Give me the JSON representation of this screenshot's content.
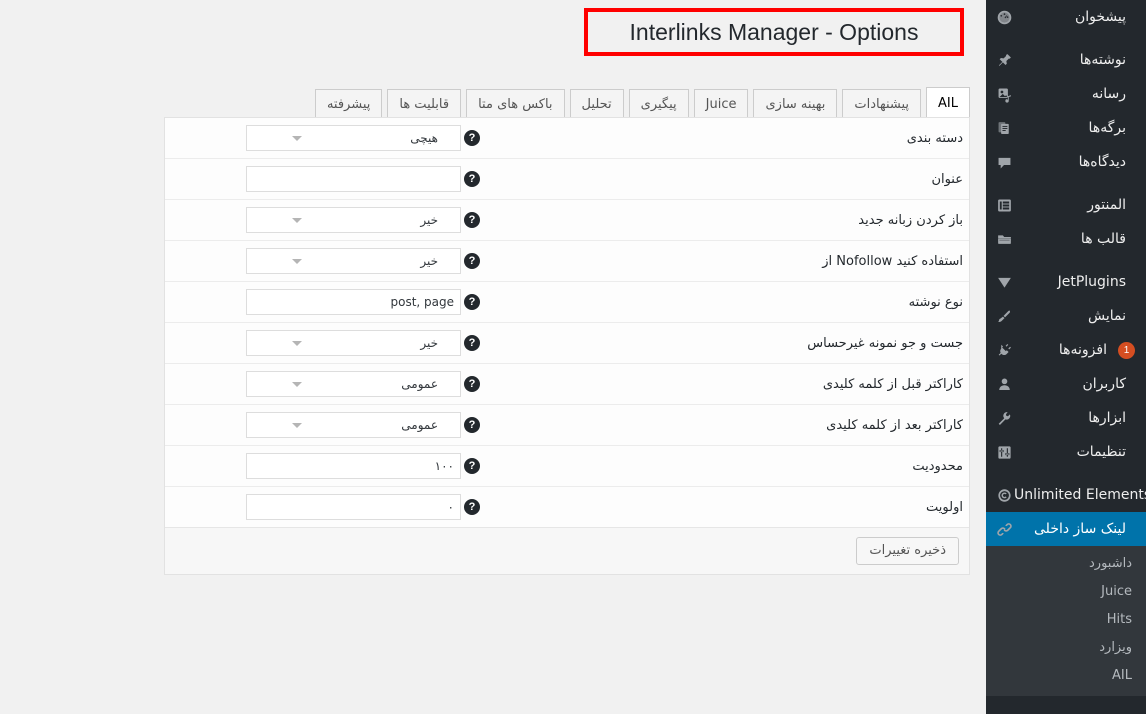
{
  "header": {
    "title": "Interlinks Manager - Options"
  },
  "sidebar": {
    "items": [
      {
        "label": "پیشخوان",
        "icon": "dashboard-icon",
        "current": false,
        "badge": null
      },
      {
        "label": "نوشته‌ها",
        "icon": "pin-icon",
        "current": false,
        "badge": null
      },
      {
        "label": "رسانه",
        "icon": "media-icon",
        "current": false,
        "badge": null
      },
      {
        "label": "برگه‌ها",
        "icon": "pages-icon",
        "current": false,
        "badge": null
      },
      {
        "label": "دیدگاه‌ها",
        "icon": "comments-icon",
        "current": false,
        "badge": null
      },
      {
        "label": "المنتور",
        "icon": "elementor-icon",
        "current": false,
        "badge": null
      },
      {
        "label": "قالب ها",
        "icon": "folder-icon",
        "current": false,
        "badge": null
      },
      {
        "label": "JetPlugins",
        "icon": "jet-triangle-icon",
        "current": false,
        "badge": null
      },
      {
        "label": "نمایش",
        "icon": "appearance-brush-icon",
        "current": false,
        "badge": null
      },
      {
        "label": "افزونه‌ها",
        "icon": "plugin-icon",
        "current": false,
        "badge": "1"
      },
      {
        "label": "کاربران",
        "icon": "users-icon",
        "current": false,
        "badge": null
      },
      {
        "label": "ابزارها",
        "icon": "tools-wrench-icon",
        "current": false,
        "badge": null
      },
      {
        "label": "تنظیمات",
        "icon": "settings-sliders-icon",
        "current": false,
        "badge": null
      },
      {
        "label": "Unlimited Elements",
        "icon": "unlimited-elements-icon",
        "current": false,
        "badge": null
      },
      {
        "label": "لینک ساز داخلی",
        "icon": "link-chain-icon",
        "current": true,
        "badge": null
      }
    ],
    "submenu": [
      {
        "label": "داشبورد"
      },
      {
        "label": "Juice"
      },
      {
        "label": "Hits"
      },
      {
        "label": "ویزارد"
      },
      {
        "label": "AIL"
      }
    ]
  },
  "tabs": [
    {
      "label": "AIL",
      "active": true
    },
    {
      "label": "پیشنهادات",
      "active": false
    },
    {
      "label": "بهینه سازی",
      "active": false
    },
    {
      "label": "Juice",
      "active": false
    },
    {
      "label": "پیگیری",
      "active": false
    },
    {
      "label": "تحلیل",
      "active": false
    },
    {
      "label": "باکس های متا",
      "active": false
    },
    {
      "label": "قابلیت ها",
      "active": false
    },
    {
      "label": "پیشرفته",
      "active": false
    }
  ],
  "form": {
    "help_glyph": "?",
    "rows": [
      {
        "label": "دسته بندی",
        "type": "select",
        "value": "هیچی",
        "placeholder": ""
      },
      {
        "label": "عنوان",
        "type": "text",
        "value": "",
        "placeholder": ""
      },
      {
        "label": "باز کردن زبانه جدید",
        "type": "select",
        "value": "خیر",
        "placeholder": ""
      },
      {
        "label": "از Nofollow استفاده کنید",
        "type": "select",
        "value": "خیر",
        "placeholder": ""
      },
      {
        "label": "نوع نوشته",
        "type": "text",
        "value": "post, page",
        "placeholder": ""
      },
      {
        "label": "جست و جو نمونه غیرحساس",
        "type": "select",
        "value": "خیر",
        "placeholder": ""
      },
      {
        "label": "کاراکتر قبل از کلمه کلیدی",
        "type": "select",
        "value": "عمومی",
        "placeholder": ""
      },
      {
        "label": "کاراکتر بعد از کلمه کلیدی",
        "type": "select",
        "value": "عمومی",
        "placeholder": ""
      },
      {
        "label": "محدودیت",
        "type": "text",
        "value": "۱۰۰",
        "placeholder": ""
      },
      {
        "label": "اولویت",
        "type": "text",
        "value": "۰",
        "placeholder": ""
      }
    ],
    "save_label": "ذخیره تغییرات"
  },
  "colors": {
    "sidebar_bg": "#23282d",
    "submenu_bg": "#32373c",
    "accent_blue": "#0073aa",
    "badge_orange": "#d54e21",
    "highlight_red": "#ff0000",
    "page_bg": "#f1f1f1"
  }
}
